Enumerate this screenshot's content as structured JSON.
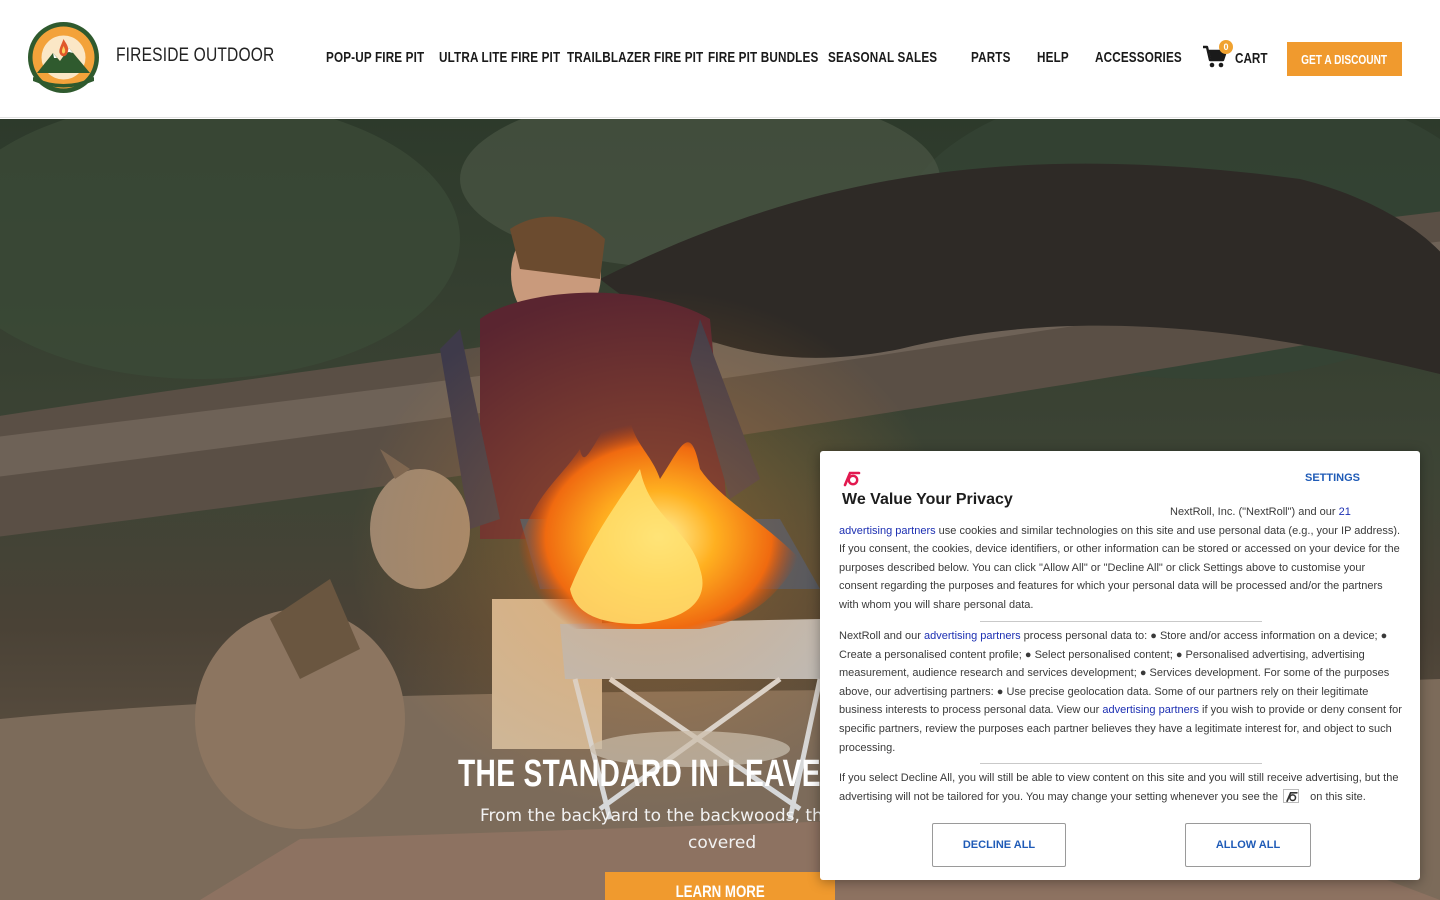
{
  "header": {
    "brand_name": "FIRESIDE OUTDOOR",
    "logo_text": "FIRESIDE OUTDOOR",
    "nav": [
      {
        "label": "POP-UP FIRE PIT"
      },
      {
        "label": "ULTRA LITE FIRE PIT"
      },
      {
        "label": "TRAILBLAZER FIRE PIT"
      },
      {
        "label": "FIRE PIT BUNDLES"
      },
      {
        "label": "SEASONAL SALES"
      },
      {
        "label": "PARTS"
      },
      {
        "label": "HELP"
      },
      {
        "label": "ACCESSORIES"
      }
    ],
    "cart": {
      "label": "CART",
      "count": "0",
      "icon": "cart-icon"
    },
    "discount_button": "GET A DISCOUNT"
  },
  "hero": {
    "title": "THE STANDARD IN LEAVE NO TRAC",
    "subtitle_line1": "From the backyard to the backwoods, the P",
    "subtitle_line2": "covered",
    "button": "LEARN MORE"
  },
  "privacy_modal": {
    "title": "We Value Your Privacy",
    "settings": "SETTINGS",
    "p1_lead": "NextRoll, Inc. (\"NextRoll\") and our ",
    "p1_link_number": "21",
    "p1_link_text": "advertising partners",
    "p1_rest": " use cookies and similar technologies on this site and use personal data (e.g., your IP address). If you consent, the cookies, device identifiers, or other information can be stored or accessed on your device for the purposes described below. You can click \"Allow All\" or \"Decline All\" or click Settings above to customise your consent regarding the purposes and features for which your personal data will be processed and/or the partners with whom you will share personal data.",
    "p2_lead": "NextRoll and our ",
    "p2_link": "advertising partners",
    "p2_mid": " process personal data to: ● Store and/or access information on a device; ● Create a personalised content profile; ● Select personalised content; ● Personalised advertising, advertising measurement, audience research and services development; ● Services development. For some of the purposes above, our advertising partners: ● Use precise geolocation data. Some of our partners rely on their legitimate business interests to process personal data. View our ",
    "p2_link2": "advertising partners",
    "p2_rest": " if you wish to provide or deny consent for specific partners, review the purposes each partner believes they have a legitimate interest for, and object to such processing.",
    "p3_lead": "If you select Decline All, you will still be able to view content on this site and you will still receive advertising, but the advertising will not be tailored for you. You may change your setting whenever you see the ",
    "p3_rest": " on this site.",
    "decline_button": "DECLINE ALL",
    "allow_button": "ALLOW ALL"
  },
  "colors": {
    "accent_orange": "#f09a2e",
    "link_blue": "#1f5bb7",
    "nextroll_pink": "#e2194f"
  }
}
